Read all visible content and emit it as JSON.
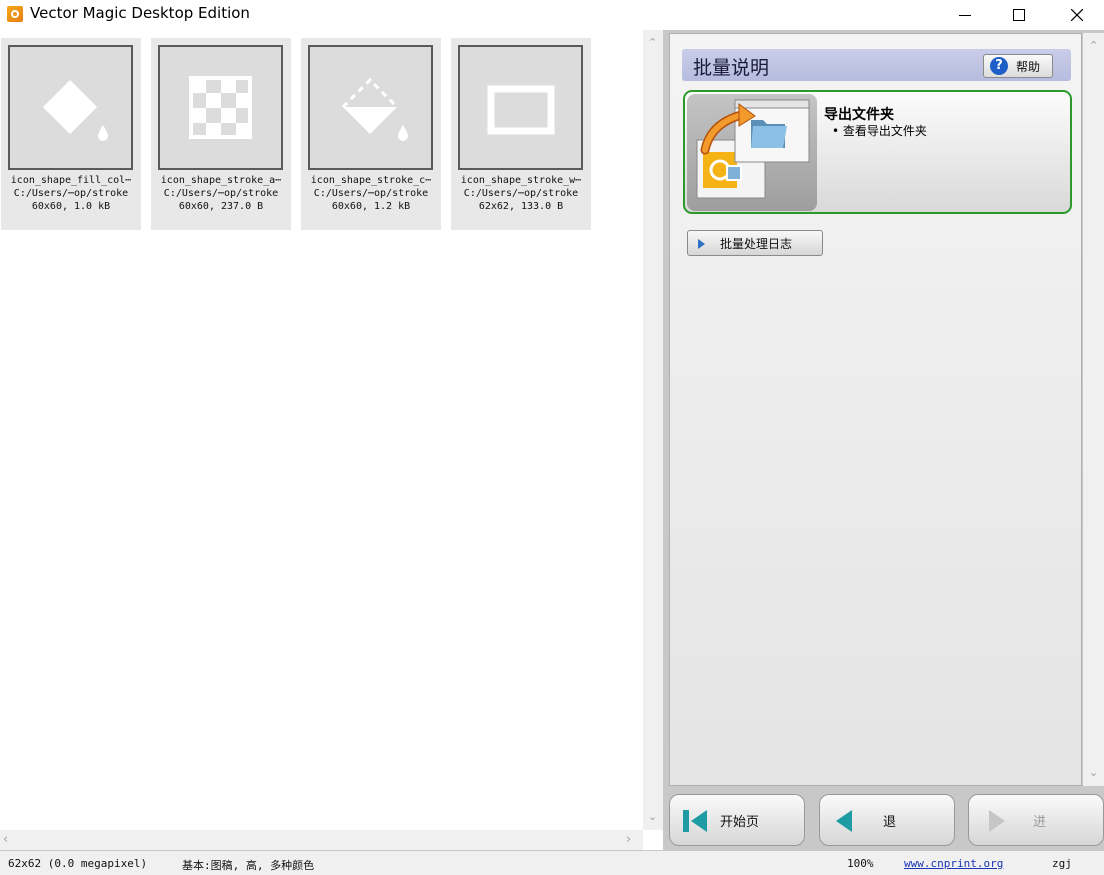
{
  "window": {
    "title": "Vector Magic Desktop Edition",
    "icons": {
      "app": "vector-magic-app-icon",
      "minimize": "minimize-icon",
      "maximize": "maximize-icon",
      "close": "close-icon"
    }
  },
  "thumbnails": [
    {
      "name": "icon_shape_fill_col⋯",
      "path": "C:/Users/⋯op/stroke",
      "info": "60x60, 1.0 kB",
      "icon": "fill-bucket-icon"
    },
    {
      "name": "icon_shape_stroke_a⋯",
      "path": "C:/Users/⋯op/stroke",
      "info": "60x60, 237.0 B",
      "icon": "checkerboard-icon"
    },
    {
      "name": "icon_shape_stroke_c⋯",
      "path": "C:/Users/⋯op/stroke",
      "info": "60x60, 1.2 kB",
      "icon": "dashed-bucket-icon"
    },
    {
      "name": "icon_shape_stroke_w⋯",
      "path": "C:/Users/⋯op/stroke",
      "info": "62x62, 133.0 B",
      "icon": "rectangle-outline-icon"
    }
  ],
  "panel": {
    "title": "批量说明",
    "help_label": "帮助",
    "export": {
      "title": "导出文件夹",
      "bullet": "• 查看导出文件夹"
    },
    "log_label": "批量处理日志"
  },
  "nav": {
    "home_label": "开始页",
    "back_label": "退",
    "forward_label": "进"
  },
  "status": {
    "image_info": "62x62 (0.0 megapixel)",
    "mode": "基本:图稿, 高, 多种颜色",
    "zoom": "100%",
    "link": "www.cnprint.org",
    "user": "zgj"
  },
  "colors": {
    "accent_green": "#2b9a2b",
    "header_blue": "#c9cde8",
    "link_blue": "#1a34b8"
  }
}
